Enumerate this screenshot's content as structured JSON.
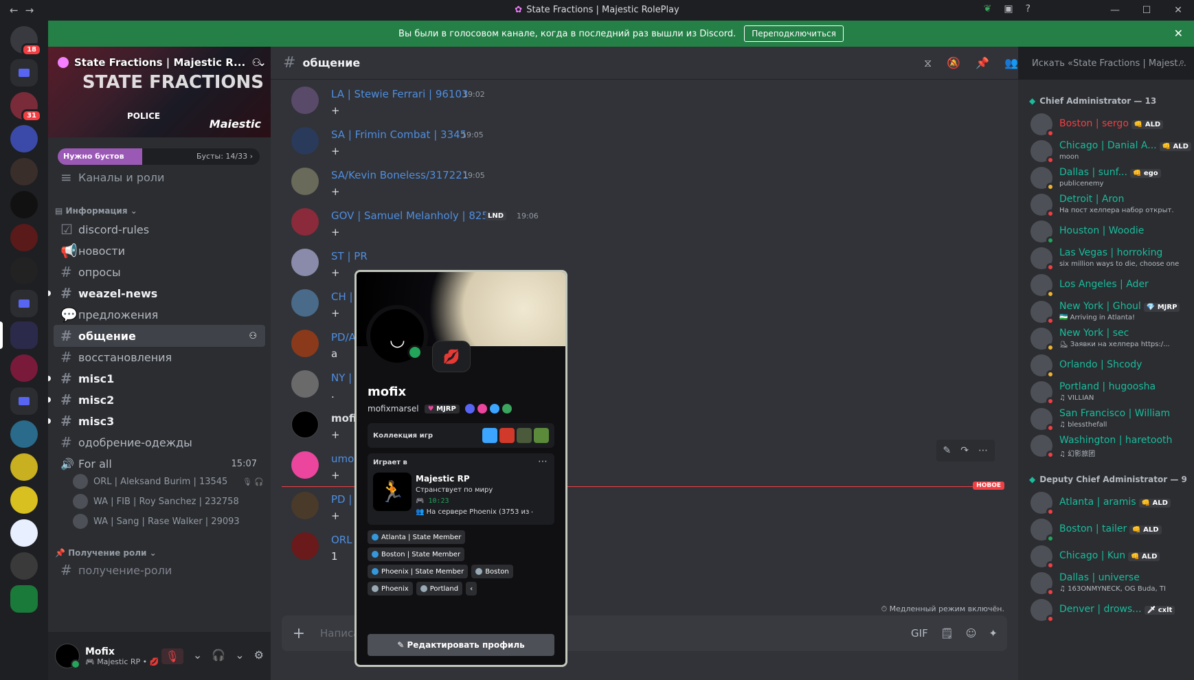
{
  "window": {
    "title": "State Fractions | Majestic RolePlay",
    "back": "←",
    "forward": "→",
    "title_glyph": "✿",
    "tb_icons": [
      "❦",
      "▣",
      "?"
    ],
    "minimize": "—",
    "maximize": "☐",
    "close": "✕"
  },
  "rail": {
    "dm_badge": "18",
    "server_badge": "31"
  },
  "notice": {
    "text": "Вы были в голосовом канале, когда в последний раз вышли из Discord.",
    "button": "Переподключиться",
    "close": "✕"
  },
  "guild": {
    "name": "State Fractions | Majestic R...",
    "chevron": "⌄",
    "invite": "⚇",
    "banner_text": "STATE FRACTIONS",
    "banner_police": "POLICE",
    "banner_logo": "Maiestic",
    "boost_left": "Нужно бустов",
    "boost_right": "Бусты: 14/33 ›",
    "boost_fraction": 0.42
  },
  "sidebar": {
    "browse": "Каналы и роли",
    "browse_icon": "≡",
    "cat_info": "Информация ⌄",
    "cat_info_icon": "▤",
    "channels": [
      {
        "icon": "☑",
        "name": "discord-rules"
      },
      {
        "icon": "📢",
        "name": "новости"
      },
      {
        "icon": "#",
        "name": "опросы"
      },
      {
        "icon": "#",
        "name": "weazel-news"
      },
      {
        "icon": "💬",
        "name": "предложения"
      },
      {
        "icon": "#",
        "name": "общение"
      },
      {
        "icon": "#",
        "name": "восстановления"
      },
      {
        "icon": "#",
        "name": "misc1"
      },
      {
        "icon": "#",
        "name": "misc2"
      },
      {
        "icon": "#",
        "name": "misc3"
      },
      {
        "icon": "#",
        "name": "одобрение-одежды"
      },
      {
        "icon": "🔊",
        "name": "For all",
        "right": "15:07"
      }
    ],
    "invite_icon": "⚇",
    "voice_users": [
      {
        "name": "ORL | Aleksand Burim | 13545",
        "icons": "🎙 🎧"
      },
      {
        "name": "WA | FIB | Roy Sanchez | 232758",
        "icons": ""
      },
      {
        "name": "WA | Sang | Rase Walker | 29093",
        "icons": ""
      }
    ],
    "cat_roles": "Получение роли ⌄",
    "cat_roles_icon": "📌",
    "cut_channel": "получение-роли"
  },
  "user": {
    "name": "Mofix",
    "status": "🎮 Majestic RP • 💋",
    "mic": "🎙",
    "mic_caret": "⌄",
    "headset": "🎧",
    "headset_caret": "⌄",
    "settings": "⚙"
  },
  "chat": {
    "channel": "общение",
    "header_icons": [
      "⧖",
      "🔕",
      "📌",
      "👥"
    ],
    "messages": [
      {
        "author": "LA | Stewie Ferrari | 96103",
        "time": "19:02",
        "body": "+"
      },
      {
        "author": "SA | Frimin Combat | 3345",
        "time": "19:05",
        "body": "+"
      },
      {
        "author": "SA/Kevin Boneless/317221",
        "time": "19:05",
        "body": "+"
      },
      {
        "author": "GOV | Samuel Melanholy | 82507",
        "tag": "LND",
        "time": "19:06",
        "body": "+"
      },
      {
        "author": "ST | PR",
        "time": "",
        "body": "+"
      },
      {
        "author": "CH | Vla",
        "time": "",
        "body": "+"
      },
      {
        "author": "PD/Art",
        "time": "",
        "body": "a"
      },
      {
        "author": "NY | Co",
        "time": "",
        "body": "."
      },
      {
        "author": "mofix",
        "time": "",
        "body": "+"
      },
      {
        "author": "umom",
        "time": "",
        "body": "+"
      },
      {
        "author": "PD | Hy",
        "time": "",
        "body": "+"
      },
      {
        "author": "ORL | F",
        "time": "",
        "body": "1"
      }
    ],
    "hover_icons": [
      "✎",
      "↷",
      "⋯"
    ],
    "new_label": "НОВОЕ",
    "slowmode": "⏱ Медленный режим включён.",
    "composer_plus": "+",
    "composer_placeholder": "Написать",
    "composer_icons": [
      "GIF",
      "🗒",
      "☺",
      "✦"
    ]
  },
  "profile": {
    "display_name": "mofix",
    "username": "mofixmarsel",
    "server_tag": "MJRP",
    "status_bubble": "💋",
    "games_label": "Коллекция игр",
    "playing_label": "Играет в",
    "playing_menu": "⋯",
    "game_icon": "🏃",
    "game_name": "Majestic RP",
    "game_state": "Странствует по миру",
    "game_time": "🎮 10:23",
    "game_server": "👥 На сервере Phoenix (3753 из 4...",
    "roles": [
      {
        "name": "Atlanta | State Member",
        "color": "#3498db"
      },
      {
        "name": "Boston | State Member",
        "color": "#3498db"
      },
      {
        "name": "Phoenix | State Member",
        "color": "#3498db"
      },
      {
        "name": "Boston",
        "color": "#99aab5"
      },
      {
        "name": "Phoenix",
        "color": "#99aab5"
      },
      {
        "name": "Portland",
        "color": "#99aab5"
      },
      {
        "name": "‹",
        "color": ""
      }
    ],
    "edit_button": "✎ Редактировать профиль"
  },
  "search": {
    "placeholder": "Искать «State Fractions | Majest...",
    "icon": "⌕"
  },
  "members": {
    "cat1_icon": "◆",
    "cat1": "Chief Administrator — 13",
    "cat1_list": [
      {
        "name": "Boston | sergo",
        "tag": "👊 ALD",
        "status": "",
        "color": "#f23f43",
        "st": "#f23f43"
      },
      {
        "name": "Chicago | Danial A...",
        "tag": "👊 ALD",
        "status": "moon",
        "color": "#1abc9c",
        "st": "#f23f43"
      },
      {
        "name": "Dallas | sunf...",
        "tag": "👊 ego",
        "status": "publicenemy",
        "color": "#1abc9c",
        "st": "#f0b232"
      },
      {
        "name": "Detroit | Aron",
        "tag": "",
        "status": "На пост хелпера набор открыт.",
        "color": "#1abc9c",
        "st": "#f23f43"
      },
      {
        "name": "Houston | Woodie",
        "tag": "",
        "status": "",
        "color": "#1abc9c",
        "st": "#23a55a"
      },
      {
        "name": "Las Vegas | horroking",
        "tag": "",
        "status": "six million ways to die, choose one",
        "color": "#1abc9c",
        "st": "#f23f43"
      },
      {
        "name": "Los Angeles | Ader",
        "tag": "",
        "status": "",
        "color": "#1abc9c",
        "st": "#f0b232"
      },
      {
        "name": "New York | Ghoul",
        "tag": "💎 MJRP",
        "status": "🇺🇿 Arriving in Atlanta!",
        "color": "#1abc9c",
        "st": "#f23f43"
      },
      {
        "name": "New York | sec",
        "tag": "",
        "status": "⛸ Заявки на хелпера https:/...",
        "color": "#1abc9c",
        "st": "#f0b232"
      },
      {
        "name": "Orlando | Shcody",
        "tag": "",
        "status": "",
        "color": "#1abc9c",
        "st": "#f0b232"
      },
      {
        "name": "Portland | hugoosha",
        "tag": "",
        "status": "♫ VILLIAN",
        "color": "#1abc9c",
        "st": "#f23f43"
      },
      {
        "name": "San Francisco | William",
        "tag": "",
        "status": "♫ blessthefall",
        "color": "#1abc9c",
        "st": "#f23f43"
      },
      {
        "name": "Washington | haretooth",
        "tag": "",
        "status": "♫ 幻影旅团",
        "color": "#1abc9c",
        "st": "#f23f43"
      }
    ],
    "cat2_icon": "◆",
    "cat2": "Deputy Chief Administrator — 9",
    "cat2_list": [
      {
        "name": "Atlanta | aramis",
        "tag": "👊 ALD",
        "status": "",
        "color": "#1abc9c",
        "st": "#f23f43"
      },
      {
        "name": "Boston | tailer",
        "tag": "👊 ALD",
        "status": "",
        "color": "#1abc9c",
        "st": "#23a55a"
      },
      {
        "name": "Chicago | Kun",
        "tag": "👊 ALD",
        "status": "",
        "color": "#1abc9c",
        "st": "#f23f43"
      },
      {
        "name": "Dallas | universe",
        "tag": "",
        "status": "♫ 163ONMYNECK, OG Buda, TI",
        "color": "#1abc9c",
        "st": "#f23f43"
      },
      {
        "name": "Denver | drows...",
        "tag": "🗡 cxlt",
        "status": "",
        "color": "#1abc9c",
        "st": "#f23f43"
      }
    ]
  }
}
